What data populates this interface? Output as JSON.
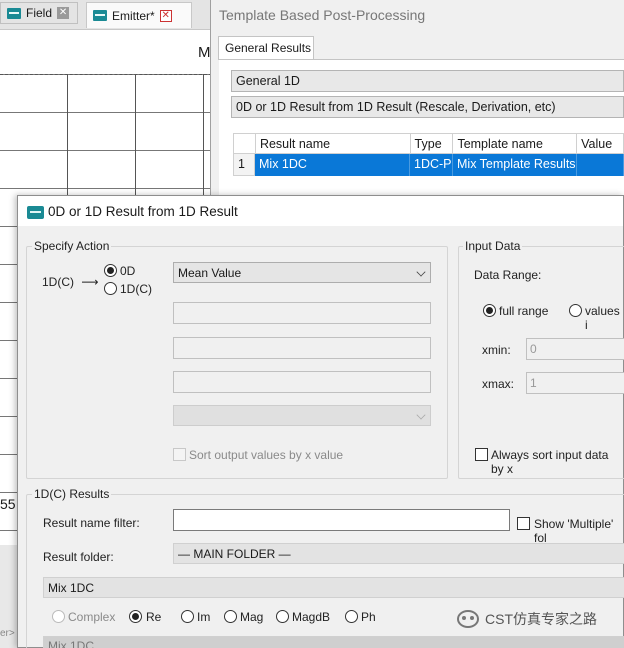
{
  "background": {
    "tabs": [
      {
        "label": "Field"
      },
      {
        "label": "Emitter*"
      }
    ],
    "plot_title_fragment": "M",
    "tick_fragment": "55",
    "status_fragment": "er>"
  },
  "template_window": {
    "title": "Template Based Post-Processing",
    "tab_label": "General Results",
    "combo_category": "General 1D",
    "combo_template": "0D or 1D Result from 1D Result (Rescale, Derivation, etc)",
    "table": {
      "headers": [
        "",
        "Result name",
        "Type",
        "Template name",
        "Value"
      ],
      "rows": [
        [
          "1",
          "Mix 1DC",
          "1DC-P",
          "Mix Template Results",
          ""
        ]
      ]
    }
  },
  "dialog": {
    "title": "0D or 1D Result from 1D Result",
    "specify_action": {
      "group_label": "Specify Action",
      "input_label": "1D(C)",
      "arrow": "⟶",
      "options": [
        "0D",
        "1D(C)"
      ],
      "selected": "0D",
      "operation": "Mean Value",
      "sort_label": "Sort output values by x value"
    },
    "input_data": {
      "group_label": "Input Data",
      "data_range_label": "Data Range:",
      "range_options": [
        "full range",
        "values i"
      ],
      "selected_range": "full range",
      "xmin_label": "xmin:",
      "xmin_value": "0",
      "xmax_label": "xmax:",
      "xmax_value": "1",
      "always_sort_label": "Always sort input data by x"
    },
    "results": {
      "group_label": "1D(C) Results",
      "filter_label": "Result name filter:",
      "filter_value": "",
      "show_multiple_label": "Show 'Multiple' fol",
      "folder_label": "Result folder:",
      "folder_value": "— MAIN FOLDER —",
      "selected_result": "Mix 1DC",
      "component_options": [
        "Complex",
        "Re",
        "Im",
        "Mag",
        "MagdB",
        "Ph"
      ],
      "selected_component": "Re",
      "bottom_item": "Mix 1DC"
    }
  },
  "watermark": "CST仿真专家之路"
}
